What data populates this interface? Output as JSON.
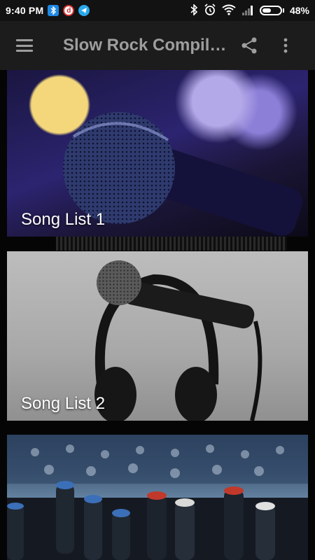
{
  "status_bar": {
    "time": "9:40 PM",
    "notifications": [
      "bluetooth-notification-icon",
      "d-app-notification-icon",
      "telegram-notification-icon"
    ],
    "battery_percent": "48%"
  },
  "toolbar": {
    "title": "Slow Rock Compila…",
    "icons": [
      "menu-icon",
      "share-icon",
      "more-vert-icon"
    ]
  },
  "cards": [
    {
      "label": "Song List 1",
      "image": "microphone-purple-bokeh"
    },
    {
      "label": "Song List 2",
      "image": "microphone-headphones-grayscale"
    },
    {
      "label": "",
      "image": "audio-mixer-knobs"
    }
  ],
  "colors": {
    "status_bar": "#121212",
    "toolbar": "#1c1c1c",
    "toolbar_text": "#9e9e9e",
    "background": "#050505"
  }
}
